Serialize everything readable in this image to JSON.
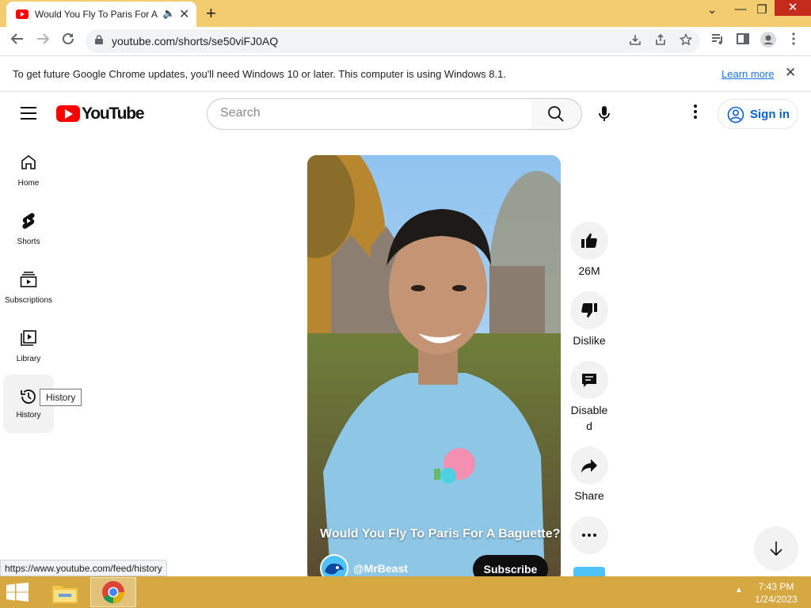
{
  "browser": {
    "tab_title": "Would You Fly To Paris For A",
    "tab_audio_icon": "speaker-icon",
    "tab_close": "✕",
    "new_tab": "+",
    "url": "youtube.com/shorts/se50viFJ0AQ",
    "window_controls": {
      "minimize": "—",
      "restore": "❐",
      "close": "✕",
      "tab_search": "⌄"
    }
  },
  "infobar": {
    "message": "To get future Google Chrome updates, you'll need Windows 10 or later. This computer is using Windows 8.1.",
    "link": "Learn more",
    "close": "✕"
  },
  "youtube": {
    "logo_text": "YouTube",
    "search": {
      "placeholder": "Search",
      "value": ""
    },
    "sign_in": "Sign in",
    "nav": [
      {
        "label": "Home",
        "icon": "home-icon"
      },
      {
        "label": "Shorts",
        "icon": "shorts-icon"
      },
      {
        "label": "Subscriptions",
        "icon": "subscriptions-icon"
      },
      {
        "label": "Library",
        "icon": "library-icon"
      },
      {
        "label": "History",
        "icon": "history-icon"
      }
    ],
    "tooltip": "History",
    "short": {
      "title": "Would You Fly To Paris For A Baguette?",
      "channel": "@MrBeast",
      "subscribe": "Subscribe"
    },
    "actions": {
      "likes": "26M",
      "dislike": "Dislike",
      "comments_1": "Disable",
      "comments_2": "d",
      "share": "Share"
    }
  },
  "status_bar_url": "https://www.youtube.com/feed/history",
  "taskbar": {
    "time": "7:43 PM",
    "date": "1/24/2023",
    "tray_arrow": "▲"
  },
  "colors": {
    "chrome_frame": "#f2cc6f",
    "taskbar": "#d6a842",
    "youtube_red": "#ff0000",
    "link_blue": "#065fd4"
  }
}
